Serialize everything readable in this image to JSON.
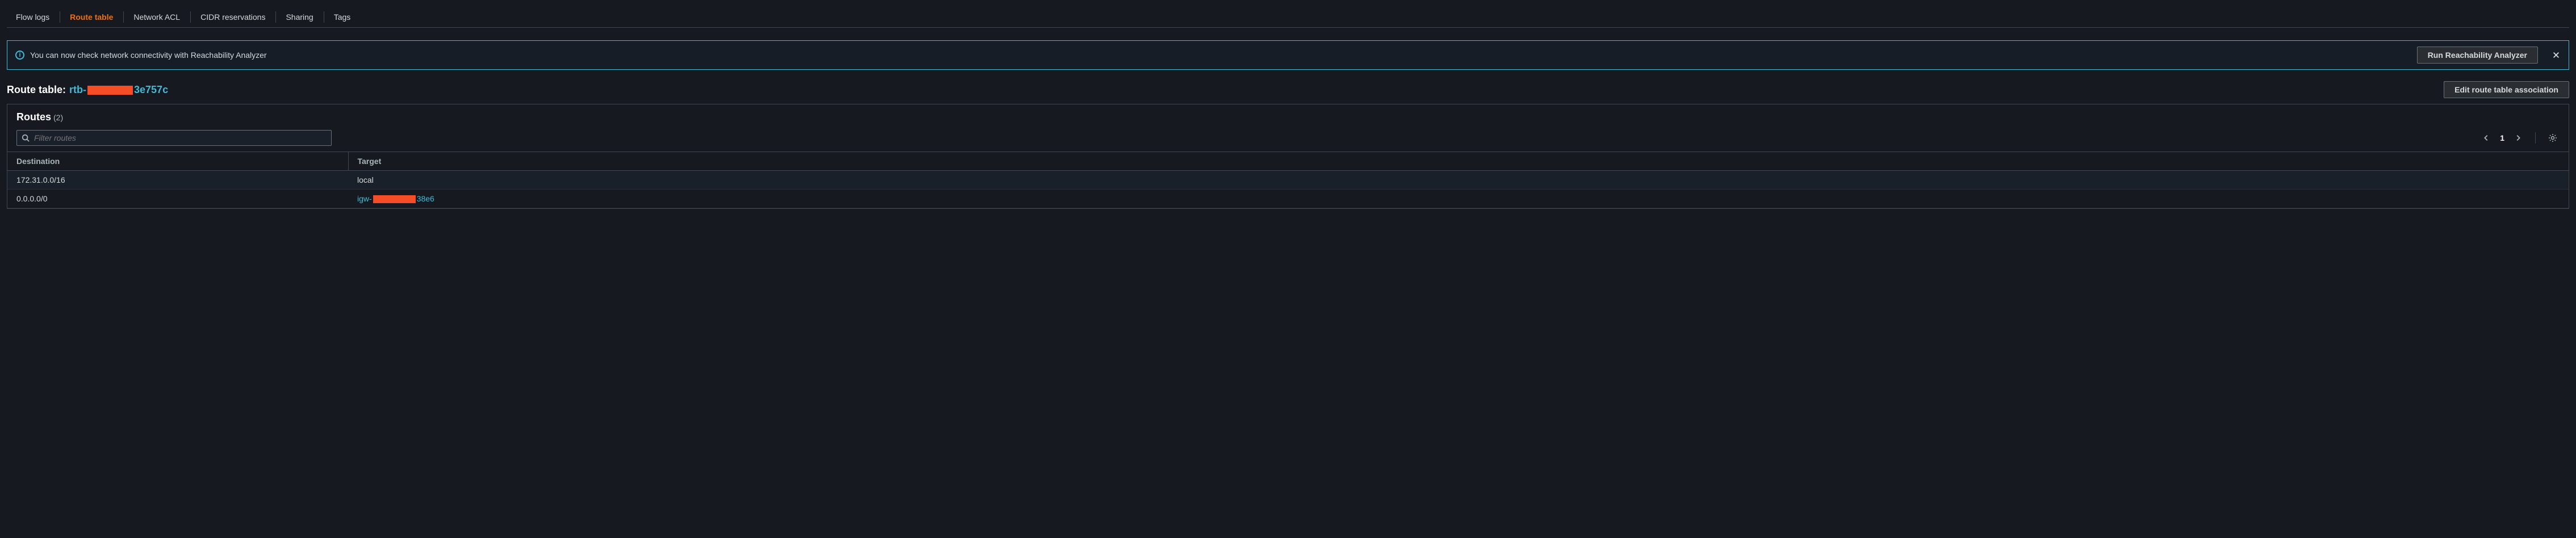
{
  "tabs": {
    "items": [
      {
        "label": "Flow logs",
        "active": false
      },
      {
        "label": "Route table",
        "active": true
      },
      {
        "label": "Network ACL",
        "active": false
      },
      {
        "label": "CIDR reservations",
        "active": false
      },
      {
        "label": "Sharing",
        "active": false
      },
      {
        "label": "Tags",
        "active": false
      }
    ]
  },
  "banner": {
    "message": "You can now check network connectivity with Reachability Analyzer",
    "action_label": "Run Reachability Analyzer"
  },
  "route_table_header": {
    "label": "Route table:",
    "link_prefix": "rtb-",
    "link_suffix": "3e757c",
    "edit_button": "Edit route table association"
  },
  "routes_panel": {
    "title": "Routes",
    "count": "(2)",
    "filter_placeholder": "Filter routes",
    "page": "1"
  },
  "table": {
    "headers": {
      "destination": "Destination",
      "target": "Target"
    },
    "rows": [
      {
        "destination": "172.31.0.0/16",
        "target_type": "text",
        "target": "local"
      },
      {
        "destination": "0.0.0.0/0",
        "target_type": "link",
        "target_prefix": "igw-",
        "target_suffix": "38e6"
      }
    ]
  }
}
